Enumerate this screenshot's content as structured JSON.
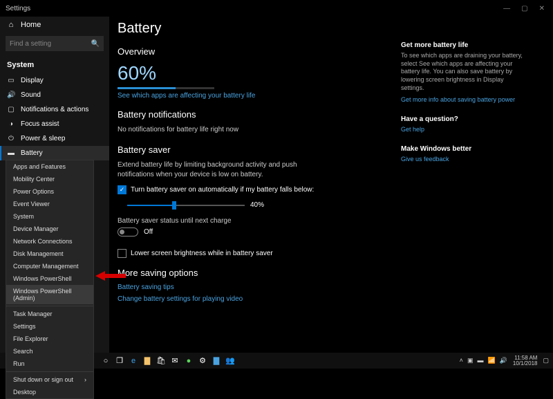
{
  "window": {
    "title": "Settings",
    "min": "—",
    "max": "▢",
    "close": "✕"
  },
  "sidebar": {
    "home": "Home",
    "search_placeholder": "Find a setting",
    "section": "System",
    "items": [
      {
        "icon": "▭",
        "label": "Display"
      },
      {
        "icon": "🔊",
        "label": "Sound"
      },
      {
        "icon": "▢",
        "label": "Notifications & actions"
      },
      {
        "icon": "◑",
        "label": "Focus assist"
      },
      {
        "icon": "⏻",
        "label": "Power & sleep"
      },
      {
        "icon": "▬",
        "label": "Battery"
      }
    ]
  },
  "winx": {
    "group1": [
      "Apps and Features",
      "Mobility Center",
      "Power Options",
      "Event Viewer",
      "System",
      "Device Manager",
      "Network Connections",
      "Disk Management",
      "Computer Management",
      "Windows PowerShell",
      "Windows PowerShell (Admin)"
    ],
    "group2": [
      "Task Manager",
      "Settings",
      "File Explorer",
      "Search",
      "Run"
    ],
    "group3_sub": "Shut down or sign out",
    "group3_last": "Desktop"
  },
  "main": {
    "title": "Battery",
    "overview": "Overview",
    "percent": "60%",
    "apps_link": "See which apps are affecting your battery life",
    "notif_h": "Battery notifications",
    "notif_body": "No notifications for battery life right now",
    "saver_h": "Battery saver",
    "saver_body": "Extend battery life by limiting background activity and push notifications when your device is low on battery.",
    "auto_label": "Turn battery saver on automatically if my battery falls below:",
    "slider_value": "40%",
    "status_label": "Battery saver status until next charge",
    "status_value": "Off",
    "lower_brightness": "Lower screen brightness while in battery saver",
    "more_h": "More saving options",
    "tips_link": "Battery saving tips",
    "video_link": "Change battery settings for playing video"
  },
  "aside": {
    "more_h": "Get more battery life",
    "more_body": "To see which apps are draining your battery, select See which apps are affecting your battery life. You can also save battery by lowering screen brightness in Display settings.",
    "more_link": "Get more info about saving battery power",
    "q_h": "Have a question?",
    "q_link": "Get help",
    "better_h": "Make Windows better",
    "better_link": "Give us feedback"
  },
  "taskbar": {
    "time": "11:58 AM",
    "date": "10/1/2018"
  }
}
